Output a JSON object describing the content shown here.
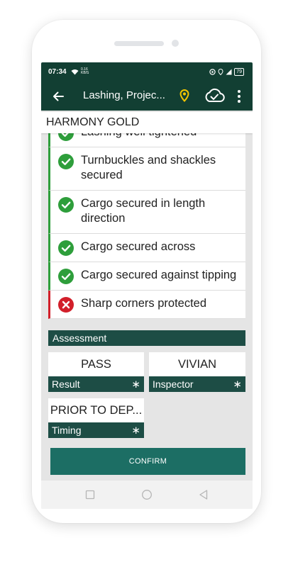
{
  "status_bar": {
    "time": "07:34",
    "network_speed": "0.16\nKB/S",
    "battery": "79"
  },
  "app_bar": {
    "title": "Lashing, Projec...",
    "back_icon": "arrow-left-icon",
    "location_icon": "map-pin-icon",
    "sync_icon": "cloud-check-icon",
    "menu_icon": "more-vertical-icon"
  },
  "vessel_name": "HARMONY GOLD",
  "checklist": {
    "items": [
      {
        "label": "Lashing well tightened",
        "status": "ok"
      },
      {
        "label": "Turnbuckles and shackles secured",
        "status": "ok"
      },
      {
        "label": "Cargo secured in length direction",
        "status": "ok"
      },
      {
        "label": "Cargo secured across",
        "status": "ok"
      },
      {
        "label": "Cargo secured against tipping",
        "status": "ok"
      },
      {
        "label": "Sharp corners protected",
        "status": "fail"
      }
    ]
  },
  "assessment": {
    "section_title": "Assessment",
    "result": {
      "value": "PASS",
      "label": "Result",
      "required_mark": "∗"
    },
    "inspector": {
      "value": "VIVIAN",
      "label": "Inspector",
      "required_mark": "∗"
    },
    "timing": {
      "value": "PRIOR TO DEP...",
      "label": "Timing",
      "required_mark": "∗"
    }
  },
  "confirm_label": "CONFIRM",
  "colors": {
    "primary_dark": "#123f33",
    "section_bar": "#1d4d45",
    "confirm": "#1c6e64",
    "ok": "#2e9e3b",
    "fail": "#d21f2a",
    "pin": "#f2c500"
  }
}
